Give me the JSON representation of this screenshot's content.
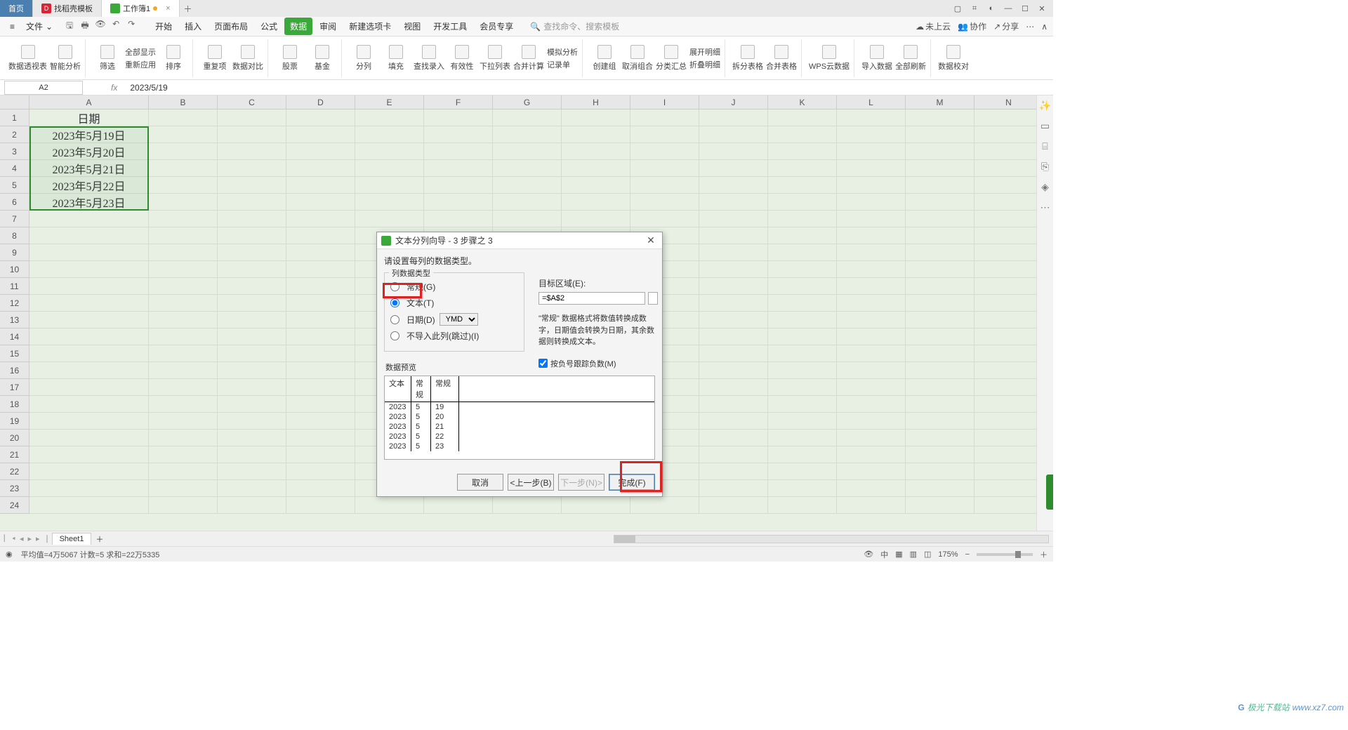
{
  "tabs": {
    "home": "首页",
    "template": "找稻壳模板",
    "workbook": "工作簿1"
  },
  "menubar": {
    "file": "文件",
    "menus": [
      "开始",
      "插入",
      "页面布局",
      "公式",
      "数据",
      "审阅",
      "新建选项卡",
      "视图",
      "开发工具",
      "会员专享"
    ],
    "active_index": 4,
    "search_placeholder": "查找命令、搜索模板"
  },
  "right_menu": {
    "cloud": "未上云",
    "coop": "协作",
    "share": "分享"
  },
  "ribbon": {
    "g1": [
      "数据透视表",
      "智能分析"
    ],
    "g2_btn": "筛选",
    "g2a": "全部显示",
    "g2b": "重新应用",
    "g3": "排序",
    "g4": [
      "重复项",
      "数据对比"
    ],
    "g5": [
      "股票",
      "基金"
    ],
    "g6": [
      "分列",
      "填充",
      "查找录入",
      "有效性",
      "下拉列表",
      "合并计算"
    ],
    "g6s1": "模拟分析",
    "g6s2": "记录单",
    "g7": [
      "创建组",
      "取消组合",
      "分类汇总"
    ],
    "g7s1": "展开明细",
    "g7s2": "折叠明细",
    "g8": [
      "拆分表格",
      "合并表格"
    ],
    "g9": [
      "WPS云数据"
    ],
    "g10": [
      "导入数据",
      "全部刷新"
    ],
    "g11": [
      "数据校对"
    ]
  },
  "formula_bar": {
    "name": "A2",
    "value": "2023/5/19"
  },
  "columns": [
    "A",
    "B",
    "C",
    "D",
    "E",
    "F",
    "G",
    "H",
    "I",
    "J",
    "K",
    "L",
    "M",
    "N"
  ],
  "rows": [
    "1",
    "2",
    "3",
    "4",
    "5",
    "6",
    "7",
    "8",
    "9",
    "10",
    "11",
    "12",
    "13",
    "14",
    "15",
    "16",
    "17",
    "18",
    "19",
    "20",
    "21",
    "22",
    "23",
    "24"
  ],
  "col_a_header": "日期",
  "col_a": [
    "2023年5月19日",
    "2023年5月20日",
    "2023年5月21日",
    "2023年5月22日",
    "2023年5月23日"
  ],
  "dialog": {
    "title": "文本分列向导 - 3 步骤之 3",
    "instruction": "请设置每列的数据类型。",
    "group_label": "列数据类型",
    "opt_general": "常规(G)",
    "opt_text": "文本(T)",
    "opt_date": "日期(D)",
    "date_fmt": "YMD",
    "opt_skip": "不导入此列(跳过)(I)",
    "target_label": "目标区域(E):",
    "target_value": "=$A$2",
    "hint": "\"常规\" 数据格式将数值转换成数字，日期值会转换为日期，其余数据则转换成文本。",
    "neg_check": "按负号跟踪负数(M)",
    "preview_label": "数据预览",
    "preview_headers": [
      "文本",
      "常规",
      "常规"
    ],
    "preview_rows": [
      [
        "2023",
        "5",
        "19"
      ],
      [
        "2023",
        "5",
        "20"
      ],
      [
        "2023",
        "5",
        "21"
      ],
      [
        "2023",
        "5",
        "22"
      ],
      [
        "2023",
        "5",
        "23"
      ]
    ],
    "btn_cancel": "取消",
    "btn_back": "<上一步(B)",
    "btn_next": "下一步(N)>",
    "btn_finish": "完成(F)"
  },
  "sheetbar": {
    "sheet": "Sheet1"
  },
  "statusbar": {
    "stats": "平均值=4万5067  计数=5  求和=22万5335",
    "ime": "中",
    "zoom": "175%"
  },
  "watermark": {
    "brand": "极光下载站",
    "url": "www.xz7.com"
  }
}
